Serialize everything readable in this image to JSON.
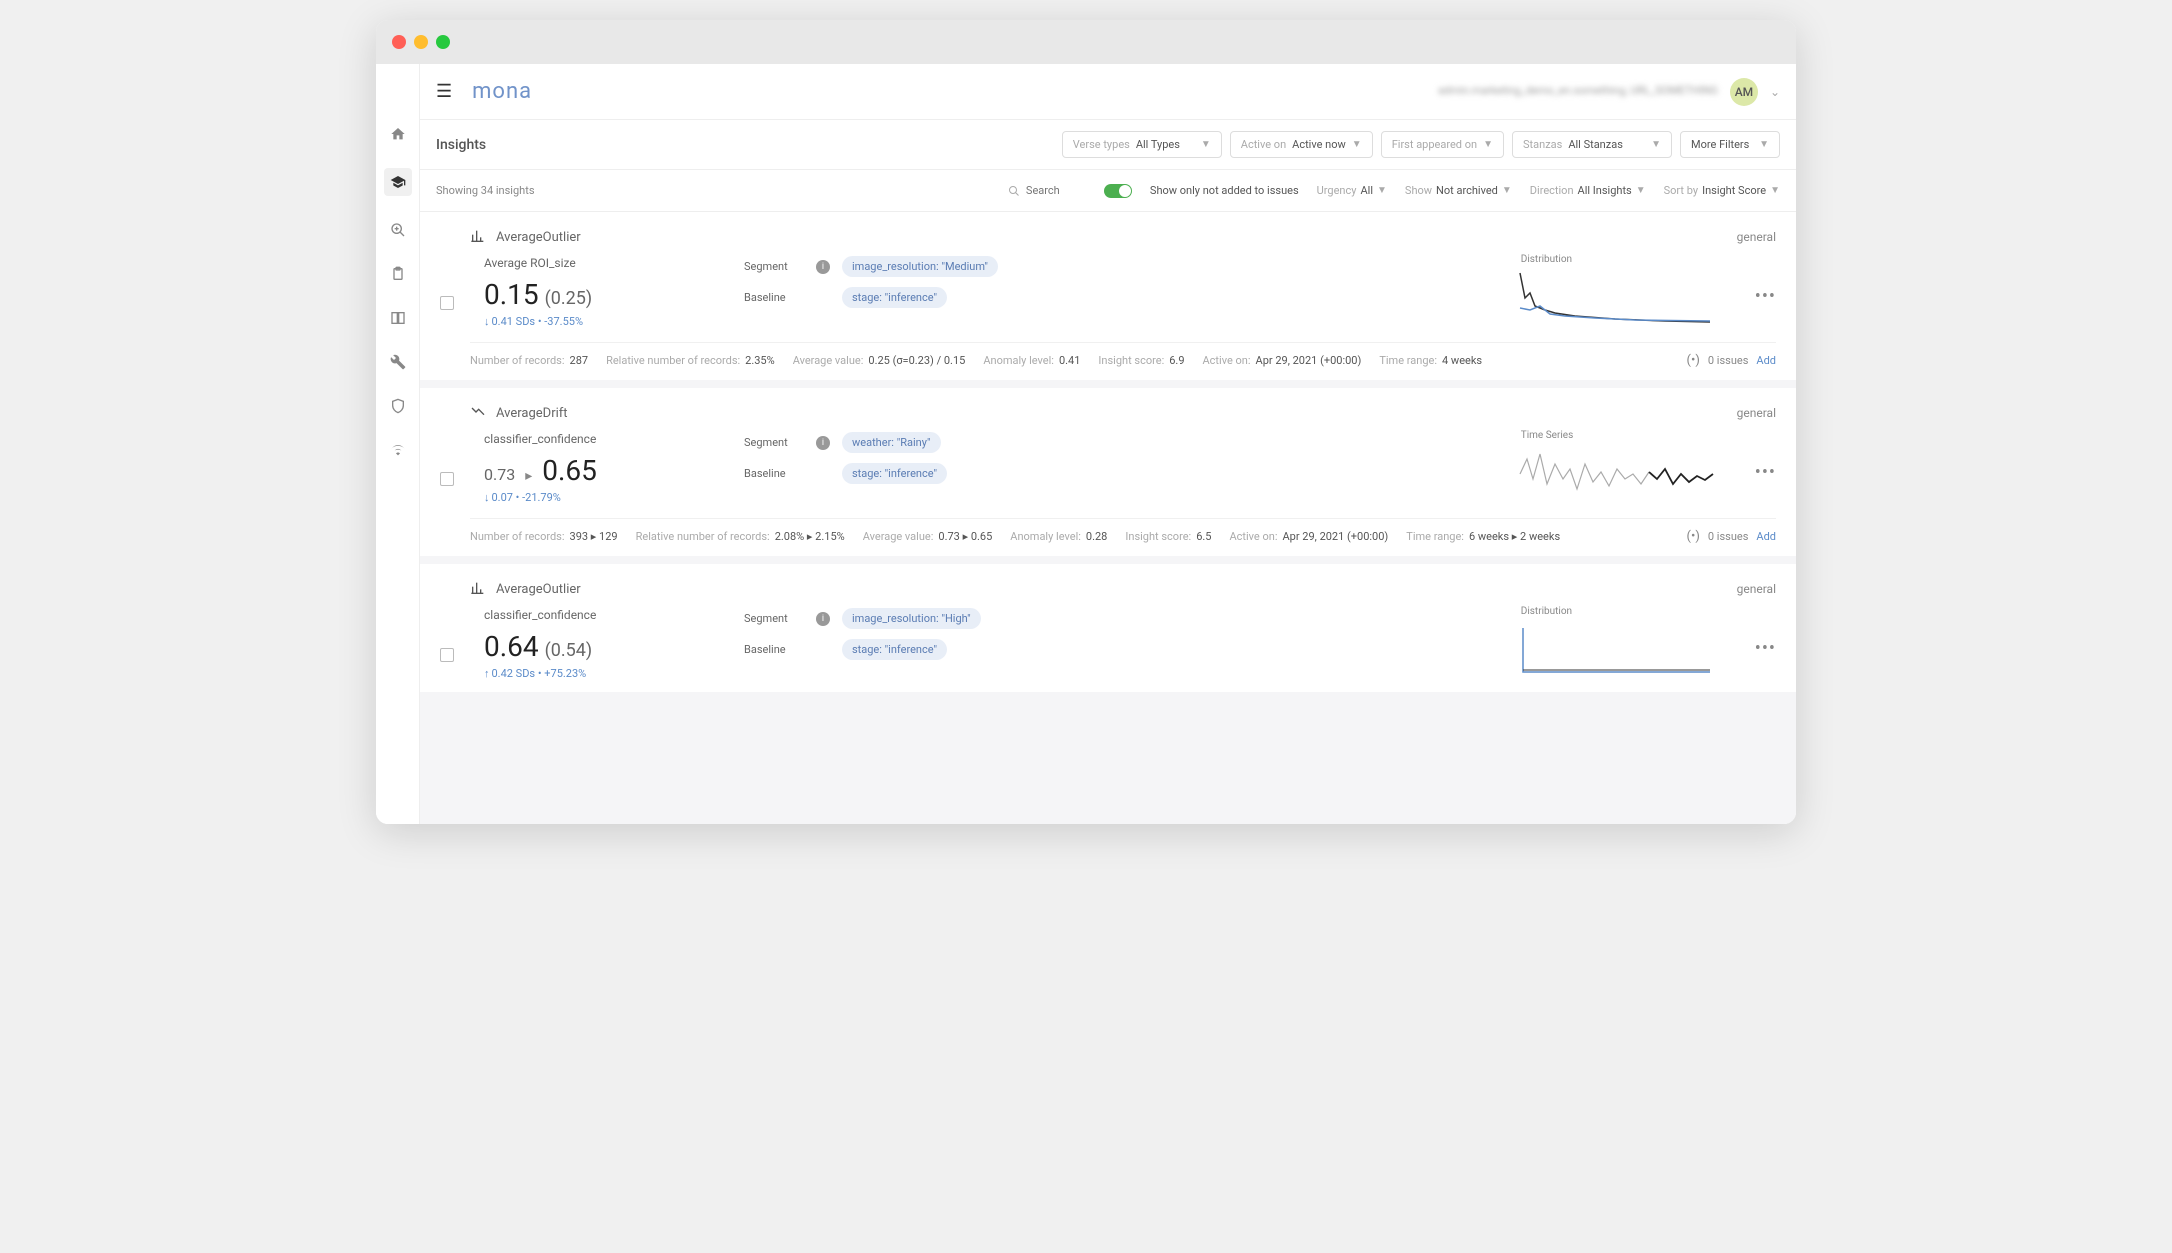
{
  "header": {
    "logo": "mona",
    "user_text": "admin.marketing_demo_en.something, URL_SOMETHING",
    "avatar": "AM"
  },
  "page": {
    "title": "Insights",
    "showing_text": "Showing 34 insights"
  },
  "filters": {
    "verse_types": {
      "label": "Verse types",
      "value": "All Types"
    },
    "active_on": {
      "label": "Active on",
      "value": "Active now"
    },
    "first_appeared": {
      "label": "First appeared on",
      "value": ""
    },
    "stanzas": {
      "label": "Stanzas",
      "value": "All Stanzas"
    },
    "more": {
      "label": "More Filters"
    }
  },
  "controls": {
    "search_placeholder": "Search",
    "toggle_label": "Show only not added to issues",
    "urgency": {
      "label": "Urgency",
      "value": "All"
    },
    "show": {
      "label": "Show",
      "value": "Not archived"
    },
    "direction": {
      "label": "Direction",
      "value": "All Insights"
    },
    "sort": {
      "label": "Sort by",
      "value": "Insight Score"
    }
  },
  "insights": [
    {
      "type": "AverageOutlier",
      "badge": "general",
      "metric_name": "Average ROI_size",
      "primary_value": "0.15",
      "secondary_value": "(0.25)",
      "delta_direction": "down",
      "delta_text": "0.41 SDs • -37.55%",
      "segment_label": "Segment",
      "segment_chip": "image_resolution: \"Medium\"",
      "baseline_label": "Baseline",
      "baseline_chip": "stage: \"inference\"",
      "chart_label": "Distribution",
      "stats": {
        "num_records": {
          "label": "Number of records:",
          "value": "287"
        },
        "rel_records": {
          "label": "Relative number of records:",
          "value": "2.35%"
        },
        "avg_value": {
          "label": "Average value:",
          "value": "0.25 (σ=0.23) / 0.15"
        },
        "anomaly": {
          "label": "Anomaly level:",
          "value": "0.41"
        },
        "score": {
          "label": "Insight score:",
          "value": "6.9"
        },
        "active_on": {
          "label": "Active on:",
          "value": "Apr 29, 2021 (+00:00)"
        },
        "time_range": {
          "label": "Time range:",
          "value": "4 weeks"
        }
      },
      "issues_count": "0 issues",
      "add_label": "Add"
    },
    {
      "type": "AverageDrift",
      "badge": "general",
      "metric_name": "classifier_confidence",
      "from_value": "0.73",
      "to_value": "0.65",
      "delta_direction": "down",
      "delta_text": "0.07 • -21.79%",
      "segment_label": "Segment",
      "segment_chip": "weather: \"Rainy\"",
      "baseline_label": "Baseline",
      "baseline_chip": "stage: \"inference\"",
      "chart_label": "Time Series",
      "stats": {
        "num_records": {
          "label": "Number of records:",
          "value": "393 ▸ 129"
        },
        "rel_records": {
          "label": "Relative number of records:",
          "value": "2.08% ▸ 2.15%"
        },
        "avg_value": {
          "label": "Average value:",
          "value": "0.73 ▸ 0.65"
        },
        "anomaly": {
          "label": "Anomaly level:",
          "value": "0.28"
        },
        "score": {
          "label": "Insight score:",
          "value": "6.5"
        },
        "active_on": {
          "label": "Active on:",
          "value": "Apr 29, 2021 (+00:00)"
        },
        "time_range": {
          "label": "Time range:",
          "value": "6 weeks ▸ 2 weeks"
        }
      },
      "issues_count": "0 issues",
      "add_label": "Add"
    },
    {
      "type": "AverageOutlier",
      "badge": "general",
      "metric_name": "classifier_confidence",
      "primary_value": "0.64",
      "secondary_value": "(0.54)",
      "delta_direction": "up",
      "delta_text": "0.42 SDs • +75.23%",
      "segment_label": "Segment",
      "segment_chip": "image_resolution: \"High\"",
      "baseline_label": "Baseline",
      "baseline_chip": "stage: \"inference\"",
      "chart_label": "Distribution"
    }
  ]
}
